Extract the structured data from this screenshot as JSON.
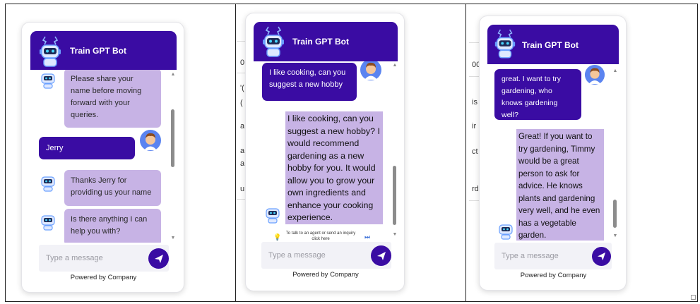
{
  "header": {
    "title": "Train GPT Bot"
  },
  "input": {
    "placeholder": "Type a message"
  },
  "footer": {
    "powered": "Powered by Company"
  },
  "icons": {
    "bot": "bot-icon",
    "user": "user-avatar-icon",
    "send": "send-icon",
    "bulb": "lightbulb-icon",
    "forward": "skip-forward-icon"
  },
  "colors": {
    "brand": "#3a0ca3",
    "bot_bubble": "#c7b3e5",
    "input_bg": "#f2f2f7"
  },
  "screen1": {
    "messages": [
      {
        "from": "bot",
        "text": "Please share your name before moving forward with your queries."
      },
      {
        "from": "user",
        "text": "Jerry"
      },
      {
        "from": "bot",
        "text": "Thanks Jerry for providing us your name"
      },
      {
        "from": "bot",
        "text": "Is there anything I can help you with?"
      }
    ]
  },
  "screen2": {
    "messages": [
      {
        "from": "user",
        "text": "I like cooking, can you suggest a new hobby"
      },
      {
        "from": "bot",
        "text": "I like cooking, can you suggest a new hobby? I would recommend gardening as a new hobby for you. It would allow you to grow your own ingredients and enhance your cooking experience."
      }
    ],
    "agent_note": "To talk to an agent or send an inquiry click here",
    "background_fragments": [
      "0",
      "'(",
      "(",
      "a",
      "a",
      "a",
      "u"
    ]
  },
  "screen3": {
    "messages": [
      {
        "from": "user",
        "text": "great. I want to try gardening, who knows gardening well?"
      },
      {
        "from": "bot",
        "text": "Great! If you want to try gardening, Timmy would be a great person to ask for advice. He knows plants and gardening very well, and he even has a vegetable garden."
      }
    ],
    "background_fragments": [
      "00",
      "is",
      "ir",
      "ct",
      "rd"
    ]
  }
}
